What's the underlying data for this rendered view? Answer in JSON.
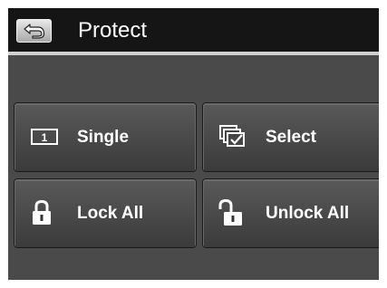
{
  "header": {
    "title": "Protect",
    "back_icon": "back-arrow-icon"
  },
  "buttons": {
    "single": {
      "label": "Single",
      "icon": "single-frame-icon",
      "icon_text": "1"
    },
    "select": {
      "label": "Select",
      "icon": "select-multiple-icon"
    },
    "lock_all": {
      "label": "Lock All",
      "icon": "lock-icon"
    },
    "unlock_all": {
      "label": "Unlock All",
      "icon": "unlock-icon"
    }
  },
  "colors": {
    "background": "#4a4a4a",
    "header": "#151515",
    "text": "#ffffff"
  }
}
